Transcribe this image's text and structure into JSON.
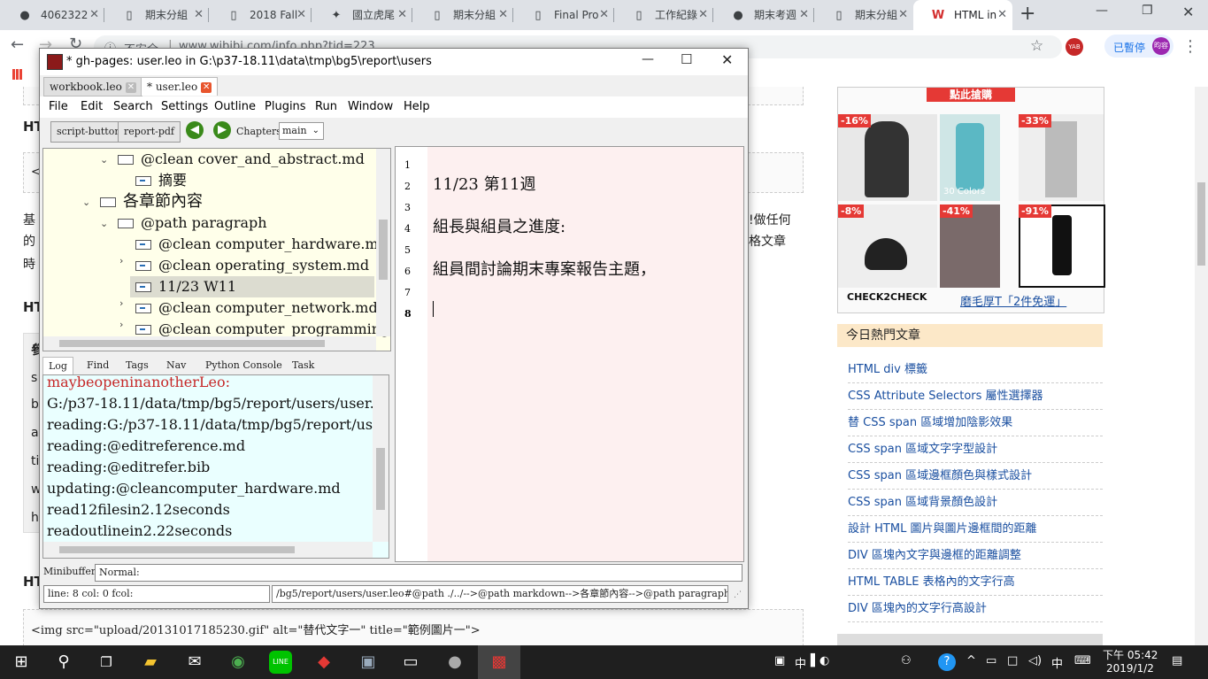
{
  "browser": {
    "tabs": [
      {
        "label": "4062322",
        "icon": "github-icon"
      },
      {
        "label": "期末分組",
        "icon": "doc-icon"
      },
      {
        "label": "2018 Fall",
        "icon": "doc-icon"
      },
      {
        "label": "國立虎尾",
        "icon": "nfu-icon"
      },
      {
        "label": "期末分組",
        "icon": "doc-icon"
      },
      {
        "label": "Final Pro",
        "icon": "doc-icon"
      },
      {
        "label": "工作紀錄",
        "icon": "doc-icon"
      },
      {
        "label": "期末考週",
        "icon": "github-icon"
      },
      {
        "label": "期末分組",
        "icon": "doc-icon"
      },
      {
        "label": "HTML in",
        "icon": "wibibi-icon"
      }
    ],
    "address_warning": "不安全",
    "address": "www.wibibi.com/info.php?tid=223",
    "paused_label": "已暫停",
    "avatar_text": "昀容",
    "ext_label": "YAB"
  },
  "webpage": {
    "left": {
      "heading1": "HT",
      "code_start": "<",
      "para_start_1": "基",
      "para_start_2": "的",
      "para_start_3": "時",
      "para_end_1": "!做任何",
      "para_end_2": "格文章",
      "heading2": "HT",
      "table_letters": [
        "參",
        "s",
        "b",
        "a",
        "ti",
        "w",
        "h"
      ],
      "heading3": "HT",
      "code_line": "<img src=\"upload/20131017185230.gif\" alt=\"替代文字一\" title=\"範例圖片一\">"
    },
    "sidebar": {
      "banner": "點此搶購",
      "discounts": [
        "-16%",
        "-33%",
        "-8%",
        "-41%",
        "-91%"
      ],
      "colors_label": "30 Colors",
      "brand": "CHECK2CHECK",
      "ad_link": "磨毛厚T「2件免運」",
      "hot_title": "今日熱門文章",
      "hot_items": [
        "HTML div 標籤",
        "CSS Attribute Selectors 屬性選擇器",
        "替 CSS span 區域增加陰影效果",
        "CSS span 區域文字字型設計",
        "CSS span 區域邊框顏色與樣式設計",
        "CSS span 區域背景顏色設計",
        "設計 HTML 圖片與圖片邊框間的距離",
        "DIV 區塊內文字與邊框的距離調整",
        "HTML TABLE 表格內的文字行高",
        "DIV 區塊內的文字行高設計"
      ]
    }
  },
  "leo": {
    "title": "* gh-pages: user.leo in G:\\p37-18.11\\data\\tmp\\bg5\\report\\users",
    "tabs": [
      {
        "label": "workbook.leo"
      },
      {
        "label": "* user.leo"
      }
    ],
    "menu": [
      "File",
      "Edit",
      "Search",
      "Settings",
      "Outline",
      "Plugins",
      "Run",
      "Window",
      "Help"
    ],
    "toolbar": {
      "script_button": "script-button",
      "report_pdf": "report-pdf",
      "chapters_label": "Chapters:",
      "chapters_value": "main"
    },
    "outline": [
      "@clean cover_and_abstract.md",
      "摘要",
      "各章節內容",
      "@path paragraph",
      "@clean computer_hardware.md",
      "@clean operating_system.md",
      "11/23 W11",
      "@clean computer_network.md",
      "@clean computer_programming.md"
    ],
    "log_tabs": [
      "Log",
      "Find",
      "Tags",
      "Nav",
      "Python Console",
      "Task"
    ],
    "log_lines": [
      "maybeopeninanotherLeo:",
      "G:/p37-18.11/data/tmp/bg5/report/users/user.leo",
      "reading:G:/p37-18.11/data/tmp/bg5/report/users/user.leo",
      "reading:@editreference.md",
      "reading:@editrefer.bib",
      "updating:@cleancomputer_hardware.md",
      "read12filesin2.12seconds",
      "readoutlinein2.22seconds"
    ],
    "body_line_numbers": [
      "1",
      "2",
      "3",
      "4",
      "5",
      "6",
      "7",
      "8"
    ],
    "body_lines": [
      "",
      "11/23 第11週",
      "",
      "組長與組員之進度:",
      "",
      "組員間討論期末專案報告主題，",
      "",
      ""
    ],
    "minibuffer_label": "Minibuffer:",
    "minibuffer_value": "Normal:",
    "status_left": "line: 8 col: 0 fcol:",
    "status_right": "/bg5/report/users/user.leo#@path ./../-->@path markdown-->各章節內容-->@path paragraph-->11/23 W11"
  },
  "taskbar": {
    "ime": "中",
    "ime2": "中",
    "time": "下午 05:42",
    "date": "2019/1/2"
  },
  "colors": {
    "outline_bg": "#ffffea",
    "log_bg": "#eaffff",
    "body_bg": "#fdf0f0",
    "accent_red": "#e53935"
  }
}
